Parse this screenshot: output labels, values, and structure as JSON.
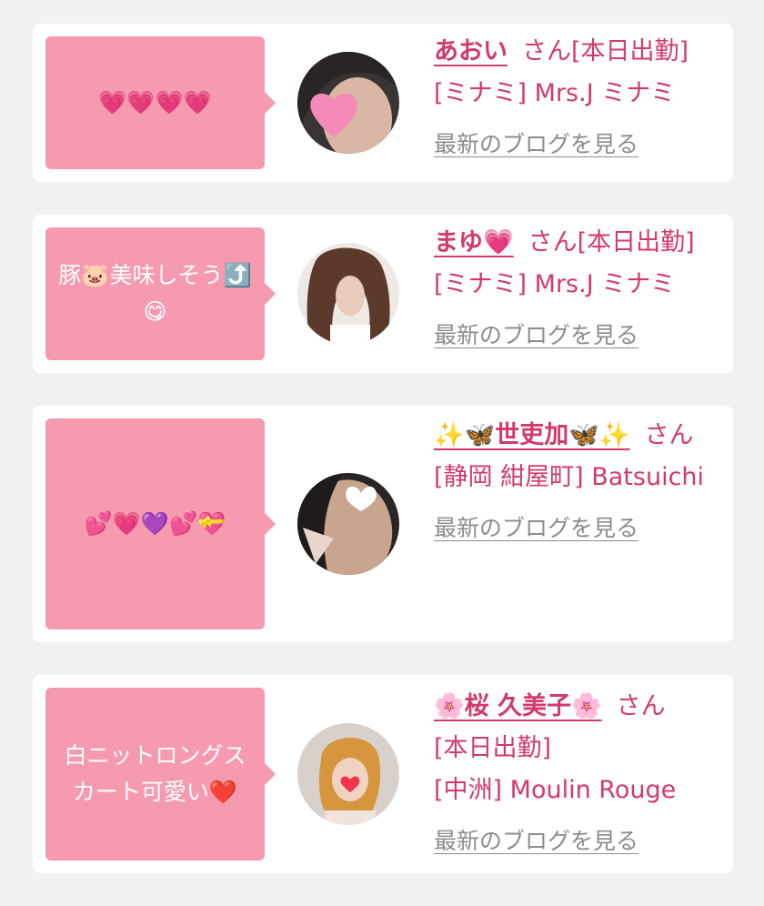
{
  "colors": {
    "accent": "#d23a6b",
    "bubble": "#f59aaf",
    "link_gray": "#8c8c8c",
    "page_bg": "#f1f1f1"
  },
  "cards": [
    {
      "bubble_text": "💗💗💗💗",
      "name": "あおい",
      "honorific": "さん",
      "status": "[本日出勤]",
      "shop": "[ミナミ] Mrs.J ミナミ",
      "blog_link": "最新のブログを見る"
    },
    {
      "bubble_text": "豚🐷美味しそう⤴️😋",
      "name": "まゆ💗",
      "honorific": "さん",
      "status": "[本日出勤]",
      "shop": "[ミナミ] Mrs.J ミナミ",
      "blog_link": "最新のブログを見る"
    },
    {
      "bubble_text": "💕💗💜💕💝",
      "name": "✨🦋世吏加🦋✨",
      "honorific": "さん",
      "status": "",
      "shop": "[静岡 紺屋町] Batsuichi",
      "blog_link": "最新のブログを見る"
    },
    {
      "bubble_text": "白ニットロングスカート可愛い❤️",
      "name": "🌸桜 久美子🌸",
      "honorific": "さん",
      "status": "[本日出勤]",
      "shop": "[中洲] Moulin Rouge",
      "blog_link": "最新のブログを見る"
    }
  ]
}
